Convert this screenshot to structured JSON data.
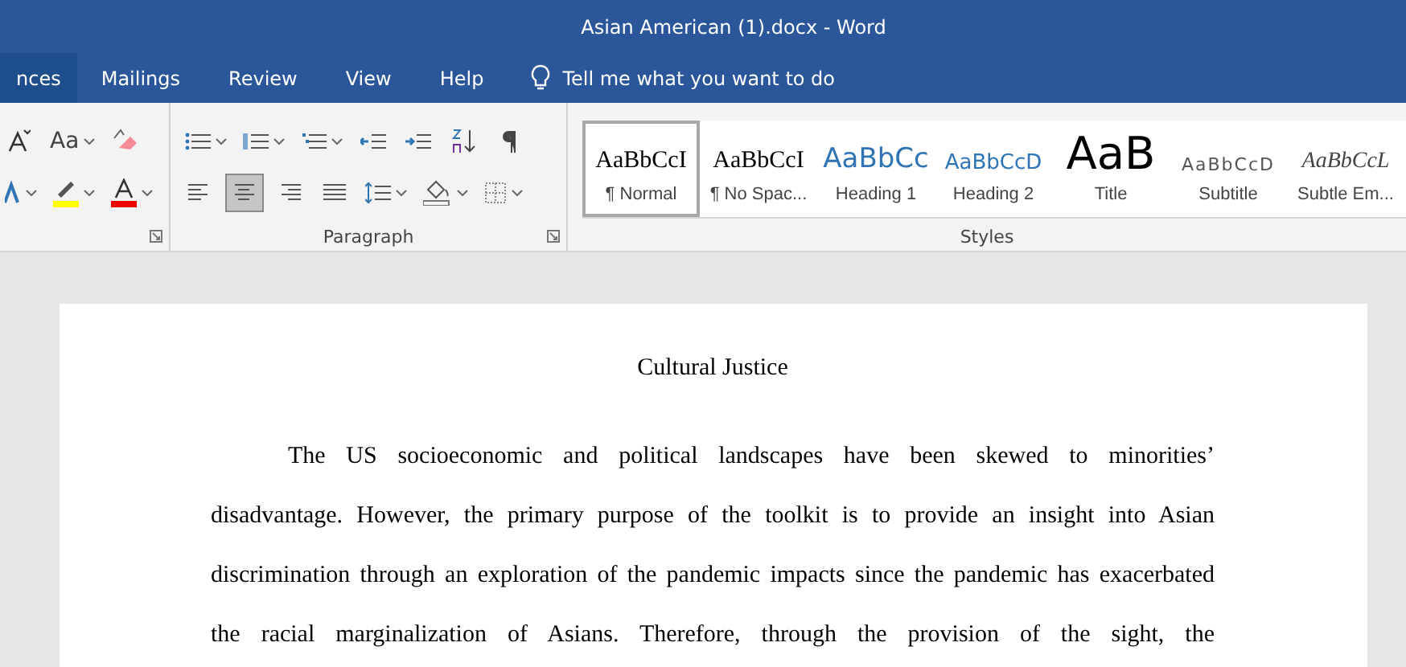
{
  "window": {
    "title": "Asian American (1).docx  -  Word"
  },
  "tabs": [
    {
      "label": "nces",
      "selected": true
    },
    {
      "label": "Mailings",
      "selected": false
    },
    {
      "label": "Review",
      "selected": false
    },
    {
      "label": "View",
      "selected": false
    },
    {
      "label": "Help",
      "selected": false
    }
  ],
  "tell_me": {
    "placeholder": "Tell me what you want to do"
  },
  "font_group": {
    "case_button": "Aa"
  },
  "paragraph_group": {
    "label": "Paragraph",
    "alignment": [
      {
        "selected": false
      },
      {
        "selected": true
      },
      {
        "selected": false
      },
      {
        "selected": false
      }
    ]
  },
  "styles_group": {
    "label": "Styles",
    "styles": [
      {
        "sample": "AaBbCcI",
        "label": "¶ Normal",
        "kind": "normal",
        "selected": true
      },
      {
        "sample": "AaBbCcI",
        "label": "¶ No Spac...",
        "kind": "normal",
        "selected": false
      },
      {
        "sample": "AaBbCc",
        "label": "Heading 1",
        "kind": "heading1",
        "selected": false
      },
      {
        "sample": "AaBbCcD",
        "label": "Heading 2",
        "kind": "heading2",
        "selected": false
      },
      {
        "sample": "AaB",
        "label": "Title",
        "kind": "title",
        "selected": false
      },
      {
        "sample": "AaBbCcD",
        "label": "Subtitle",
        "kind": "subtitle",
        "selected": false
      },
      {
        "sample": "AaBbCcL",
        "label": "Subtle Em...",
        "kind": "emphasis",
        "selected": false
      }
    ]
  },
  "document": {
    "title": "Cultural Justice",
    "lines": [
      "The US socioeconomic and political landscapes have been skewed to minorities’",
      "disadvantage. However, the primary purpose of the toolkit is to provide an insight into Asian",
      "discrimination through an exploration of the pandemic impacts since the pandemic has exacerbated",
      "the racial marginalization of Asians. Therefore, through the provision of the sight, the"
    ]
  }
}
